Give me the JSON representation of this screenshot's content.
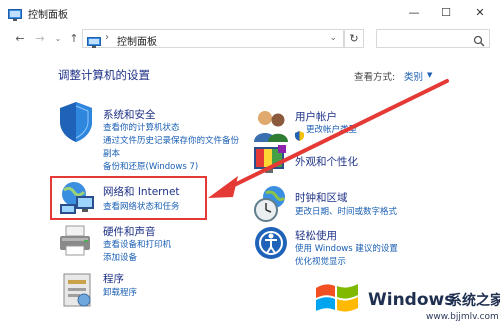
{
  "window": {
    "title": "控制面板",
    "minimize_glyph": "—",
    "maximize_glyph": "☐",
    "close_glyph": "✕"
  },
  "navigation": {
    "back_glyph": "←",
    "forward_glyph": "→",
    "recent_glyph": "⌄",
    "up_glyph": "↑",
    "address_separator": "›",
    "address_text": "控制面板",
    "address_dropdown_glyph": "⌄",
    "refresh_glyph": "↻",
    "search_placeholder": ""
  },
  "content": {
    "heading": "调整计算机的设置",
    "view_by_label": "查看方式:",
    "view_by_value": "类别",
    "view_by_arrow": "▼"
  },
  "categories": [
    {
      "icon": "shield-icon",
      "title": "系统和安全",
      "links": [
        "查看你的计算机状态",
        "通过文件历史记录保存你的文件备份",
        "副本",
        "备份和还原(Windows 7)"
      ]
    },
    {
      "icon": "network-icon",
      "title": "网络和 Internet",
      "links": [
        "查看网络状态和任务"
      ]
    },
    {
      "icon": "printer-icon",
      "title": "硬件和声音",
      "links": [
        "查看设备和打印机",
        "添加设备"
      ]
    },
    {
      "icon": "programs-icon",
      "title": "程序",
      "links": [
        "卸载程序"
      ]
    },
    {
      "icon": "users-icon",
      "title": "用户帐户",
      "links": [
        "更改帐户类型"
      ]
    },
    {
      "icon": "appearance-icon",
      "title": "外观和个性化",
      "links": []
    },
    {
      "icon": "clock-icon",
      "title": "时钟和区域",
      "links": [
        "更改日期、时间或数字格式"
      ]
    },
    {
      "icon": "accessibility-icon",
      "title": "轻松使用",
      "links": [
        "使用 Windows 建议的设置",
        "优化视觉显示"
      ]
    }
  ],
  "watermark": {
    "brand": "Windows",
    "suffix": "系统之家",
    "url": "www.bjjmlv.com",
    "colors": {
      "red": "#f25022",
      "green": "#7fba00",
      "blue": "#00a4ef",
      "yellow": "#ffb900"
    }
  },
  "annotation": {
    "highlight_color": "#e53935"
  }
}
